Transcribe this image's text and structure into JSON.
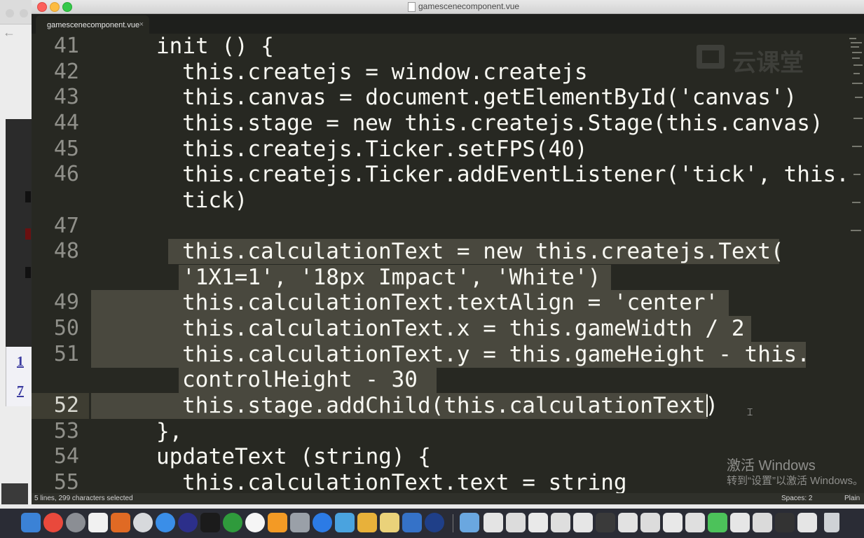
{
  "window": {
    "title": "gamescenecomponent.vue",
    "tab_label": "gamescenecomponent.vue",
    "tab_close": "×"
  },
  "background": {
    "back_arrow": "←",
    "link_1": "1",
    "link_2": "7"
  },
  "editor": {
    "lines": [
      {
        "num": "41",
        "text": "init () {"
      },
      {
        "num": "42",
        "text": "this.createjs = window.createjs"
      },
      {
        "num": "43",
        "text": "this.canvas = document.getElementById('canvas')"
      },
      {
        "num": "44",
        "text": "this.stage = new this.createjs.Stage(this.canvas)"
      },
      {
        "num": "45",
        "text": "this.createjs.Ticker.setFPS(40)"
      },
      {
        "num": "46",
        "text": "this.createjs.Ticker.addEventListener('tick', this."
      },
      {
        "num": "",
        "text": "tick)"
      },
      {
        "num": "47",
        "text": ""
      },
      {
        "num": "48",
        "text": "this.calculationText = new this.createjs.Text("
      },
      {
        "num": "",
        "text": "'1X1=1', '18px Impact', 'White')"
      },
      {
        "num": "49",
        "text": "this.calculationText.textAlign = 'center'"
      },
      {
        "num": "50",
        "text": "this.calculationText.x = this.gameWidth / 2"
      },
      {
        "num": "51",
        "text": "this.calculationText.y = this.gameHeight - this."
      },
      {
        "num": "",
        "text": "controlHeight - 30"
      },
      {
        "num": "52",
        "text": "this.stage.addChild(this.calculationText)"
      },
      {
        "num": "53",
        "text": "},"
      },
      {
        "num": "54",
        "text": "updateText (string) {"
      },
      {
        "num": "55",
        "text": "this.calculationText.text = string"
      }
    ]
  },
  "watermark": {
    "brand_text": "云课堂",
    "activate_title": "激活 Windows",
    "activate_sub": "转到“设置”以激活 Windows。"
  },
  "status": {
    "selection": "5 lines, 299 characters selected",
    "spaces": "Spaces: 2",
    "syntax": "Plain"
  },
  "colors": {
    "editor_bg": "#272822",
    "selection": "#49483e",
    "gutter": "#90908a",
    "text": "#f8f8f2"
  }
}
